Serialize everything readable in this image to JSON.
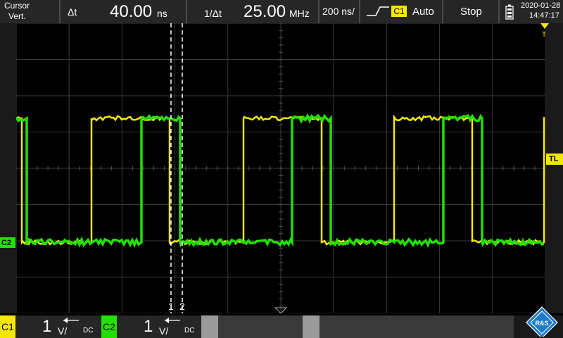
{
  "topbar": {
    "cursor_title": "Cursor",
    "cursor_mode": "Vert.",
    "delta_t_label": "Δt",
    "delta_t_value": "40.00",
    "delta_t_unit": "ns",
    "inv_delta_t_label": "1/Δt",
    "inv_delta_t_value": "25.00",
    "inv_delta_t_unit": "MHz",
    "timebase": "200 ns/",
    "trigger_source": "C1",
    "trigger_mode": "Auto",
    "run_state": "Stop",
    "date": "2020-01-28",
    "time": "14:47:17"
  },
  "screen": {
    "trigger_marker": "T",
    "trigger_level_marker": "TL",
    "c2_marker": "C2",
    "cursor1_label": "1",
    "cursor2_label": "2"
  },
  "channels": {
    "c1": {
      "label": "C1",
      "scale": "1",
      "unit": "V/",
      "coupling": "DC",
      "color": "#f5e800"
    },
    "c2": {
      "label": "C2",
      "scale": "1",
      "unit": "V/",
      "coupling": "DC",
      "color": "#22e000"
    }
  },
  "logo": "R&S",
  "colors": {
    "trace_c1": "#f5e800",
    "trace_c2": "#22e000",
    "grid": "#3a3a3a",
    "cursor": "#ffffff"
  }
}
